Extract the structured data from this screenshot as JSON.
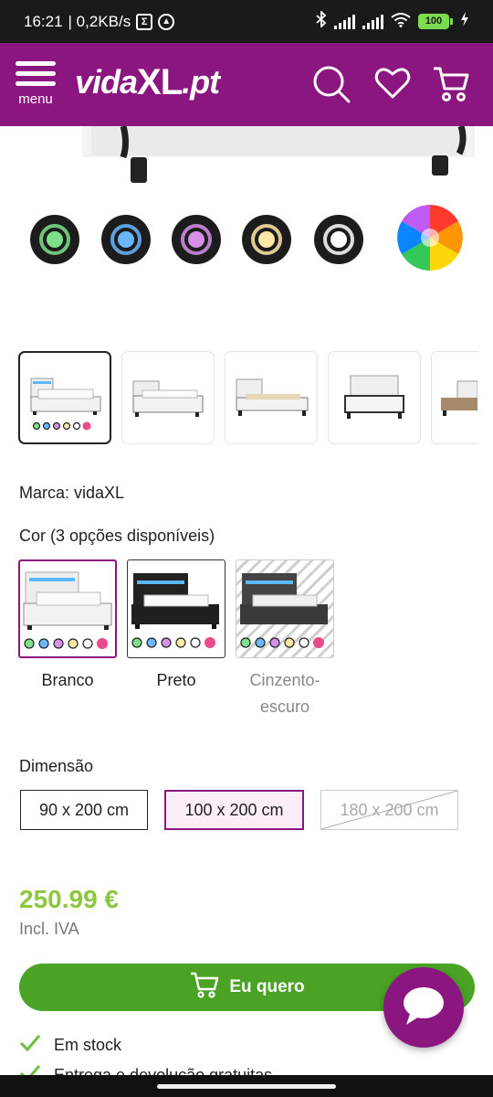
{
  "status_bar": {
    "time": "16:21",
    "network_speed": "| 0,2KB/s",
    "badge_icon": "Σ",
    "battery": "100"
  },
  "header": {
    "menu_label": "menu",
    "logo_text_a": "vida",
    "logo_text_b": "XL",
    "logo_text_c": ".pt",
    "brand_color": "#8c1680"
  },
  "hero": {
    "light_colors": [
      "#7ee08a",
      "#69b7ff",
      "#d790e8",
      "#ffe7a6",
      "#ffffff"
    ]
  },
  "thumbnails": {
    "selected_index": 0,
    "count": 5
  },
  "product": {
    "brand_line": "Marca: vidaXL",
    "color_heading": "Cor (3 opções disponíveis)",
    "colors": [
      {
        "name": "Branco",
        "state": "selected"
      },
      {
        "name": "Preto",
        "state": "available"
      },
      {
        "name": "Cinzento-escuro",
        "state": "unavailable"
      }
    ],
    "dimension_heading": "Dimensão",
    "dimensions": [
      {
        "label": "90 x 200 cm",
        "state": "available"
      },
      {
        "label": "100 x 200 cm",
        "state": "selected"
      },
      {
        "label": "180 x 200 cm",
        "state": "unavailable"
      }
    ],
    "price": "250.99 €",
    "vat": "Incl. IVA",
    "buy_label": "Eu quero",
    "perks": [
      "Em stock",
      "Entrega e devolução gratuitas"
    ]
  },
  "colors": {
    "accent": "#8c1680",
    "price": "#8dc63f",
    "cta": "#4aa325"
  }
}
